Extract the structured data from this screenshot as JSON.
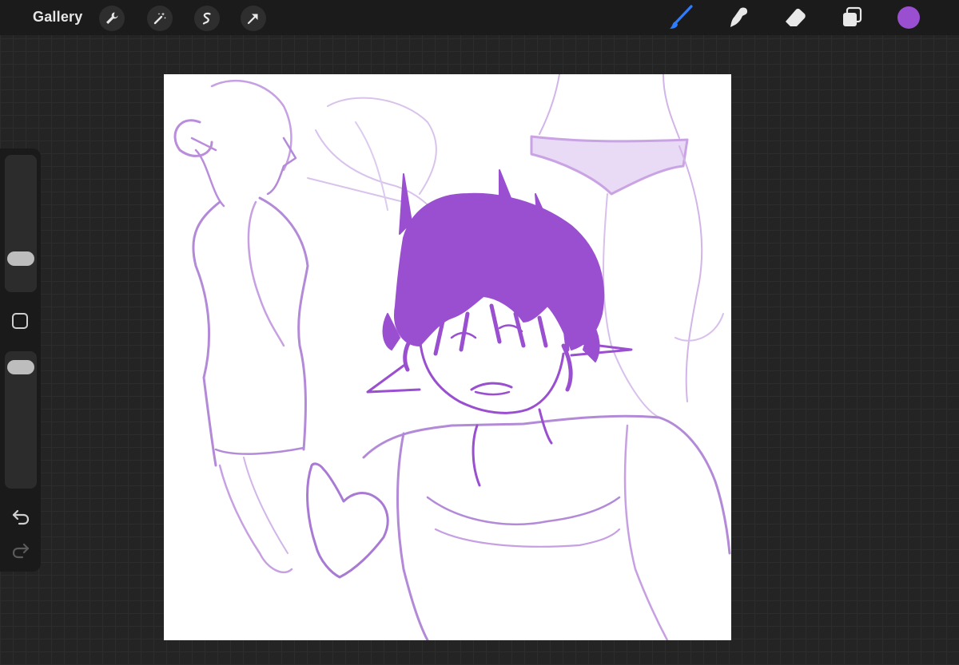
{
  "topbar": {
    "gallery_label": "Gallery",
    "left_tools": [
      "wrench-icon",
      "magic-wand-icon",
      "selection-icon",
      "transform-arrow-icon"
    ],
    "right_tools": [
      "brush-icon",
      "smudge-icon",
      "eraser-icon",
      "layers-icon"
    ],
    "current_color": "#9a4fd0",
    "active_tool_color": "#2f7dff"
  },
  "sidebar": {
    "brush_size_level": 0.2,
    "opacity_level": 0.95,
    "icons": [
      "modify-square-icon",
      "undo-icon",
      "redo-icon"
    ]
  },
  "canvas": {
    "background": "#ffffff",
    "stroke_color": "#9a4fd0"
  }
}
